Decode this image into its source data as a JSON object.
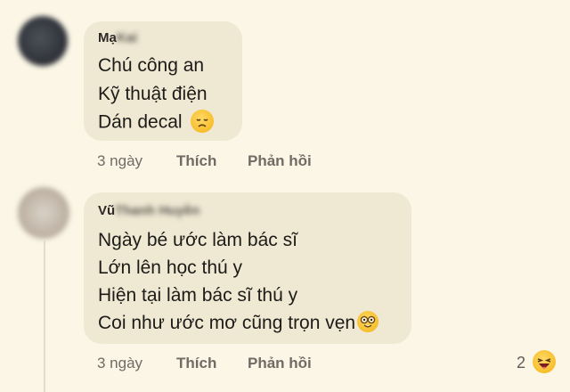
{
  "comments": [
    {
      "author_first": "Mạ",
      "author_hidden": "Kai",
      "lines": [
        "Chú công an",
        "Kỹ thuật điện",
        "Dán decal"
      ],
      "emoji": "disappointed-face-icon",
      "time": "3 ngày",
      "like_label": "Thích",
      "reply_label": "Phản hồi"
    },
    {
      "author_first": "Vũ",
      "author_hidden": "Thanh Huyền",
      "lines": [
        "Ngày bé ước làm bác sĩ",
        "Lớn lên học thú y",
        "Hiện tại làm bác sĩ thú y",
        "Coi như ước mơ cũng trọn vẹn"
      ],
      "emoji": "nerd-face-icon",
      "time": "3 ngày",
      "like_label": "Thích",
      "reply_label": "Phản hồi",
      "reaction_count": "2",
      "reaction_icon": "laughing-face-icon"
    }
  ]
}
